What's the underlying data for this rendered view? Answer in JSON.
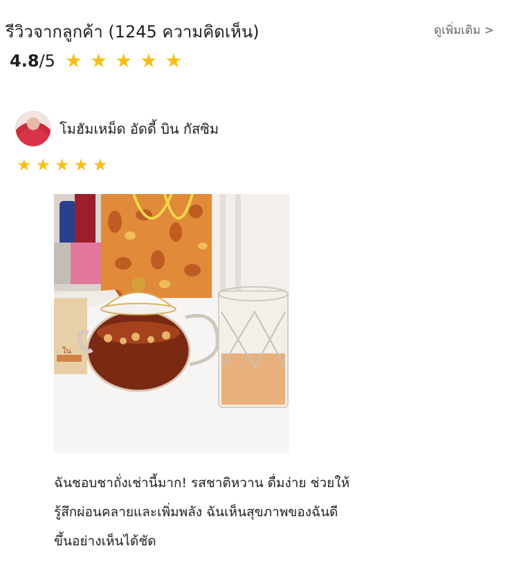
{
  "header": {
    "title": "รีวิวจากลูกค้า (1245 ความคิดเห็น)",
    "see_more": "ดูเพิ่มเติม >"
  },
  "rating": {
    "score": "4.8",
    "out_of": "/5",
    "stars_value": 5,
    "stars_max": 5,
    "star_color": "#f6bf15"
  },
  "review": {
    "reviewer_name": "โมฮัมเหม็ด อัดดี้ บิน กัสซิม",
    "stars_value": 5,
    "stars_max": 5,
    "text_line1": "ฉันชอบชาถั่งเช่านี้มาก! รสชาติหวาน ดื่มง่าย ช่วยให้",
    "text_line2": "รู้สึกผ่อนคลายและเพิ่มพลัง ฉันเห็นสุขภาพของฉันดี",
    "text_line3": "ขึ้นอย่างเห็นได้ชัด"
  }
}
